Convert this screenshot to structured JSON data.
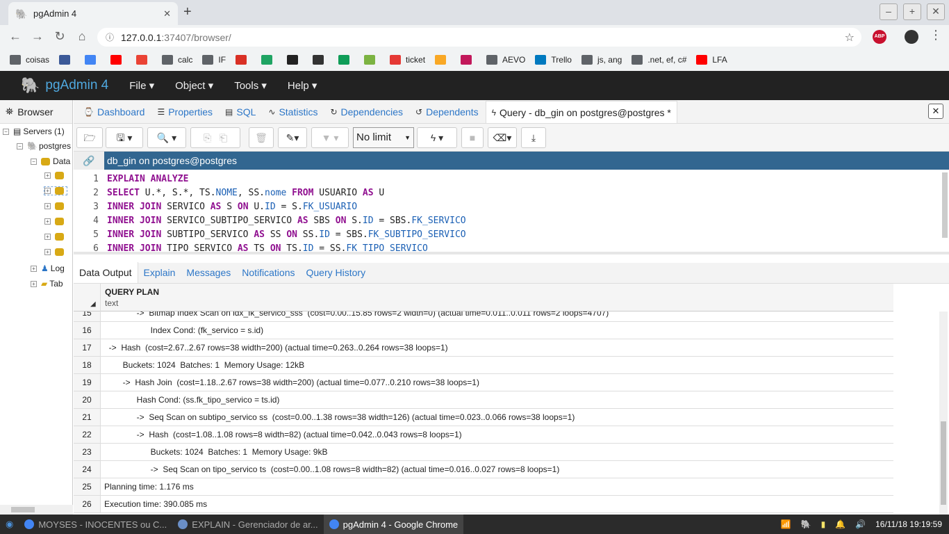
{
  "window": {
    "tab_title": "pgAdmin 4",
    "tab_close": "✕",
    "new_tab": "+",
    "minimize": "–",
    "maximize": "+",
    "close": "✕"
  },
  "address": {
    "host": "127.0.0.1",
    "path": ":37407/browser/",
    "abp": "ABP"
  },
  "bookmarks": [
    {
      "label": "coisas",
      "icon": "folder-icon"
    },
    {
      "label": "",
      "icon": "facebook-icon",
      "color": "#3b5998"
    },
    {
      "label": "",
      "icon": "translate-icon",
      "color": "#4285f4"
    },
    {
      "label": "",
      "icon": "youtube-icon",
      "color": "#ff0000"
    },
    {
      "label": "",
      "icon": "google-icon",
      "color": "#ea4335"
    },
    {
      "label": "calc",
      "icon": "folder-icon"
    },
    {
      "label": "IF",
      "icon": "folder-icon"
    },
    {
      "label": "",
      "icon": "gmail-icon",
      "color": "#d93025"
    },
    {
      "label": "",
      "icon": "drive-icon",
      "color": "#1fa463"
    },
    {
      "label": "",
      "icon": "tux-icon",
      "color": "#222222"
    },
    {
      "label": "",
      "icon": "robot-icon",
      "color": "#333333"
    },
    {
      "label": "",
      "icon": "sync-icon",
      "color": "#0f9d58"
    },
    {
      "label": "",
      "icon": "download-icon",
      "color": "#7cb342"
    },
    {
      "label": "ticket",
      "icon": "ticket-icon",
      "color": "#e53935"
    },
    {
      "label": "",
      "icon": "bee-icon",
      "color": "#f9a825"
    },
    {
      "label": "",
      "icon": "dm-icon",
      "color": "#c2185b"
    },
    {
      "label": "AEVO",
      "icon": "folder-icon"
    },
    {
      "label": "Trello",
      "icon": "trello-icon",
      "color": "#0079bf"
    },
    {
      "label": "js, ang",
      "icon": "folder-icon"
    },
    {
      "label": ".net, ef, c#",
      "icon": "folder-icon"
    },
    {
      "label": "LFA",
      "icon": "youtube-icon",
      "color": "#ff0000"
    }
  ],
  "pgadmin": {
    "brand": "pgAdmin 4",
    "menus": [
      "File ▾",
      "Object ▾",
      "Tools ▾",
      "Help ▾"
    ]
  },
  "browser_panel": {
    "title": "Browser",
    "servers": "Servers (1)",
    "server": "postgres",
    "databases": "Data",
    "logins": "Log",
    "tablespaces": "Tab"
  },
  "tabs": [
    {
      "label": "Dashboard",
      "icon": "⌚"
    },
    {
      "label": "Properties",
      "icon": "☰"
    },
    {
      "label": "SQL",
      "icon": "▤"
    },
    {
      "label": "Statistics",
      "icon": "∿"
    },
    {
      "label": "Dependencies",
      "icon": "↻"
    },
    {
      "label": "Dependents",
      "icon": "↺"
    },
    {
      "label": "Query - db_gin on postgres@postgres *",
      "icon": "ϟ"
    }
  ],
  "query_toolbar": {
    "limit": "No limit"
  },
  "connection": {
    "label": "db_gin on postgres@postgres"
  },
  "editor": {
    "lines": [
      {
        "n": "1",
        "html": "<span class='kw'>EXPLAIN ANALYZE</span>"
      },
      {
        "n": "2",
        "html": "<span class='kw'>SELECT</span> U.*, S.*, TS.<span class='fld'>NOME</span>, SS.<span class='fld'>nome</span> <span class='kw'>FROM</span> USUARIO <span class='kw'>AS</span> U"
      },
      {
        "n": "3",
        "html": "<span class='kw'>INNER JOIN</span> SERVICO <span class='kw'>AS</span> S <span class='kw'>ON</span> U.<span class='fld'>ID</span> = S.<span class='fld'>FK_USUARIO</span>"
      },
      {
        "n": "4",
        "html": "<span class='kw'>INNER JOIN</span> SERVICO_SUBTIPO_SERVICO <span class='kw'>AS</span> SBS <span class='kw'>ON</span> S.<span class='fld'>ID</span> = SBS.<span class='fld'>FK_SERVICO</span>"
      },
      {
        "n": "5",
        "html": "<span class='kw'>INNER JOIN</span> SUBTIPO_SERVICO <span class='kw'>AS</span> SS <span class='kw'>ON</span> SS.<span class='fld'>ID</span> = SBS.<span class='fld'>FK_SUBTIPO_SERVICO</span>"
      },
      {
        "n": "6",
        "html": "<span class='kw'>INNER JOIN</span> TIPO_SERVICO <span class='kw'>AS</span> TS <span class='kw'>ON</span> TS.<span class='fld'>ID</span> = SS.<span class='fld'>FK_TIPO_SERVICO</span>"
      }
    ]
  },
  "result_tabs": [
    "Data Output",
    "Explain",
    "Messages",
    "Notifications",
    "Query History"
  ],
  "grid": {
    "column_name": "QUERY PLAN",
    "column_type": "text",
    "rows": [
      {
        "n": "15",
        "text": "              ->  Bitmap Index Scan on idx_fk_servico_sss  (cost=0.00..15.85 rows=2 width=0) (actual time=0.011..0.011 rows=2 loops=4707)"
      },
      {
        "n": "16",
        "text": "                    Index Cond: (fk_servico = s.id)"
      },
      {
        "n": "17",
        "text": "  ->  Hash  (cost=2.67..2.67 rows=38 width=200) (actual time=0.263..0.264 rows=38 loops=1)"
      },
      {
        "n": "18",
        "text": "        Buckets: 1024  Batches: 1  Memory Usage: 12kB"
      },
      {
        "n": "19",
        "text": "        ->  Hash Join  (cost=1.18..2.67 rows=38 width=200) (actual time=0.077..0.210 rows=38 loops=1)"
      },
      {
        "n": "20",
        "text": "              Hash Cond: (ss.fk_tipo_servico = ts.id)"
      },
      {
        "n": "21",
        "text": "              ->  Seq Scan on subtipo_servico ss  (cost=0.00..1.38 rows=38 width=126) (actual time=0.023..0.066 rows=38 loops=1)"
      },
      {
        "n": "22",
        "text": "              ->  Hash  (cost=1.08..1.08 rows=8 width=82) (actual time=0.042..0.043 rows=8 loops=1)"
      },
      {
        "n": "23",
        "text": "                    Buckets: 1024  Batches: 1  Memory Usage: 9kB"
      },
      {
        "n": "24",
        "text": "                    ->  Seq Scan on tipo_servico ts  (cost=0.00..1.08 rows=8 width=82) (actual time=0.016..0.027 rows=8 loops=1)"
      },
      {
        "n": "25",
        "text": "Planning time: 1.176 ms"
      },
      {
        "n": "26",
        "text": "Execution time: 390.085 ms"
      }
    ]
  },
  "taskbar": {
    "items": [
      {
        "label": "MOYSES - INOCENTES ou C...",
        "active": false,
        "color": "#4285f4"
      },
      {
        "label": "EXPLAIN - Gerenciador de ar...",
        "active": false,
        "color": "#6a8fc7"
      },
      {
        "label": "pgAdmin 4 - Google Chrome",
        "active": true,
        "color": "#4285f4"
      }
    ],
    "clock": "16/11/18 19:19:59"
  }
}
